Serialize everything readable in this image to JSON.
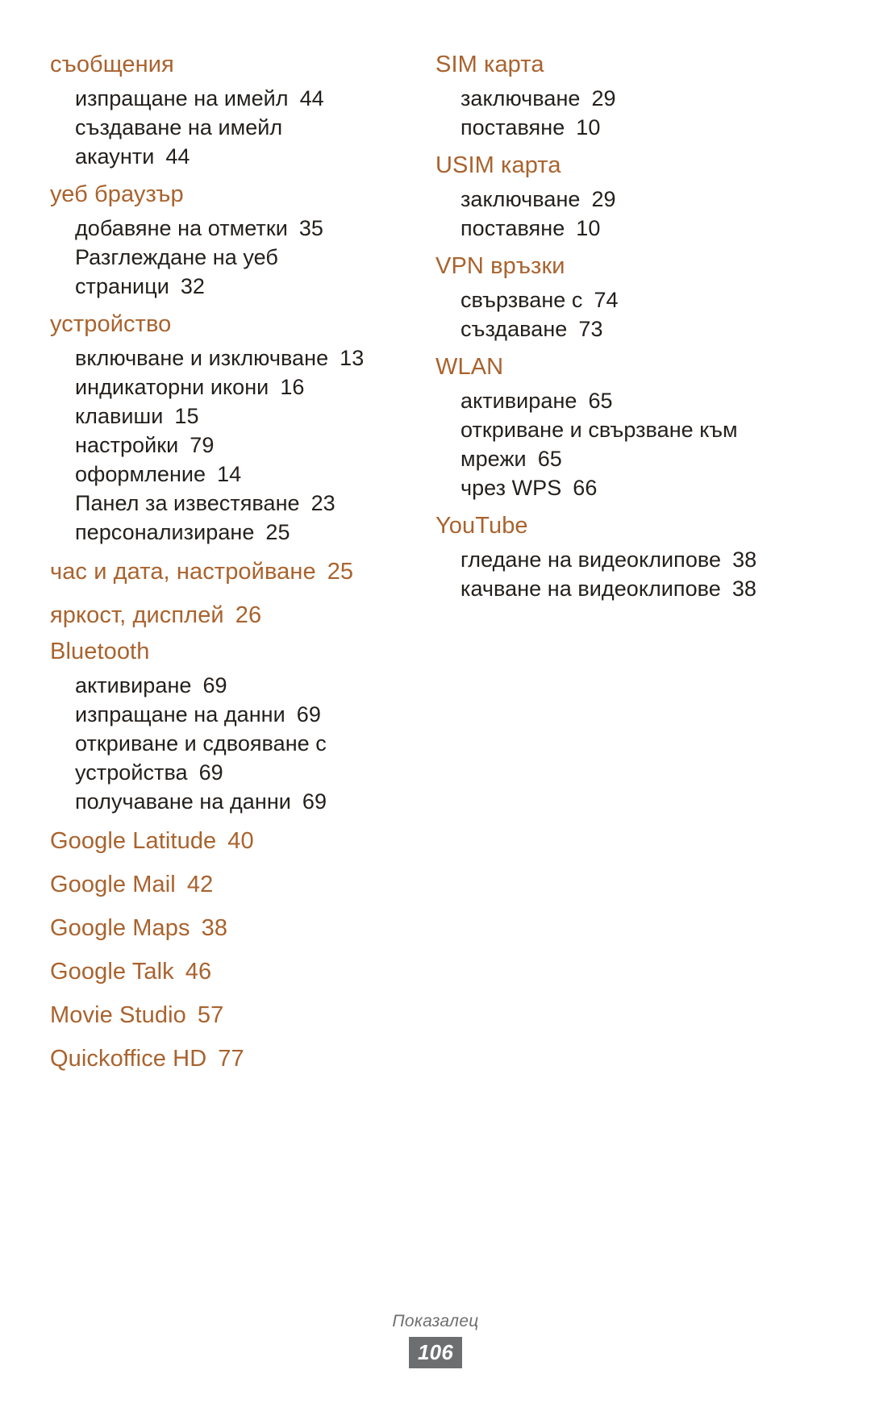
{
  "page": {
    "number": "106",
    "footer_label": "Показалец",
    "accent_color": "#a9632e",
    "body_color": "#231f1c",
    "page_box_color": "#6d6e70"
  },
  "columns": [
    {
      "name": "left",
      "groups": [
        {
          "heading": "съобщения",
          "heading_page": "",
          "entries": [
            {
              "label": "изпращане на имейл",
              "page": "44"
            },
            {
              "label": "създаване на имейл акаунти",
              "page": "44"
            }
          ]
        },
        {
          "heading": "уеб браузър",
          "heading_page": "",
          "entries": [
            {
              "label": "добавяне на отметки",
              "page": "35"
            },
            {
              "label": "Разглеждане на уеб страници",
              "page": "32"
            }
          ]
        },
        {
          "heading": "устройство",
          "heading_page": "",
          "entries": [
            {
              "label": "включване и изключване",
              "page": "13"
            },
            {
              "label": "индикаторни икони",
              "page": "16"
            },
            {
              "label": "клавиши",
              "page": "15"
            },
            {
              "label": "настройки",
              "page": "79"
            },
            {
              "label": "оформление",
              "page": "14"
            },
            {
              "label": "Панел за известяване",
              "page": "23"
            },
            {
              "label": "персонализиране",
              "page": "25"
            }
          ]
        },
        {
          "heading": "час и дата, настройване",
          "heading_page": "25",
          "entries": []
        },
        {
          "heading": "яркост, дисплей",
          "heading_page": "26",
          "entries": []
        },
        {
          "heading": "Bluetooth",
          "heading_page": "",
          "entries": [
            {
              "label": "активиране",
              "page": "69"
            },
            {
              "label": "изпращане на данни",
              "page": "69"
            },
            {
              "label": "откриване и сдвояване с устройства",
              "page": "69"
            },
            {
              "label": "получаване на данни",
              "page": "69"
            }
          ]
        },
        {
          "heading": "Google Latitude",
          "heading_page": "40",
          "entries": []
        },
        {
          "heading": "Google Mail",
          "heading_page": "42",
          "entries": []
        },
        {
          "heading": "Google Maps",
          "heading_page": "38",
          "entries": []
        },
        {
          "heading": "Google Talk",
          "heading_page": "46",
          "entries": []
        },
        {
          "heading": "Movie Studio",
          "heading_page": "57",
          "entries": []
        },
        {
          "heading": "Quickoffice HD",
          "heading_page": "77",
          "entries": []
        }
      ]
    },
    {
      "name": "right",
      "groups": [
        {
          "heading": "SIM карта",
          "heading_page": "",
          "entries": [
            {
              "label": "заключване",
              "page": "29"
            },
            {
              "label": "поставяне",
              "page": "10"
            }
          ]
        },
        {
          "heading": "USIM карта",
          "heading_page": "",
          "entries": [
            {
              "label": "заключване",
              "page": "29"
            },
            {
              "label": "поставяне",
              "page": "10"
            }
          ]
        },
        {
          "heading": "VPN връзки",
          "heading_page": "",
          "entries": [
            {
              "label": "свързване с",
              "page": "74"
            },
            {
              "label": "създаване",
              "page": "73"
            }
          ]
        },
        {
          "heading": "WLAN",
          "heading_page": "",
          "entries": [
            {
              "label": "активиране",
              "page": "65"
            },
            {
              "label": "откриване и свързване към мрежи",
              "page": "65"
            },
            {
              "label": "чрез WPS",
              "page": "66"
            }
          ]
        },
        {
          "heading": "YouTube",
          "heading_page": "",
          "entries": [
            {
              "label": "гледане на видеоклипове",
              "page": "38"
            },
            {
              "label": "качване на видеоклипове",
              "page": "38"
            }
          ]
        }
      ]
    }
  ]
}
